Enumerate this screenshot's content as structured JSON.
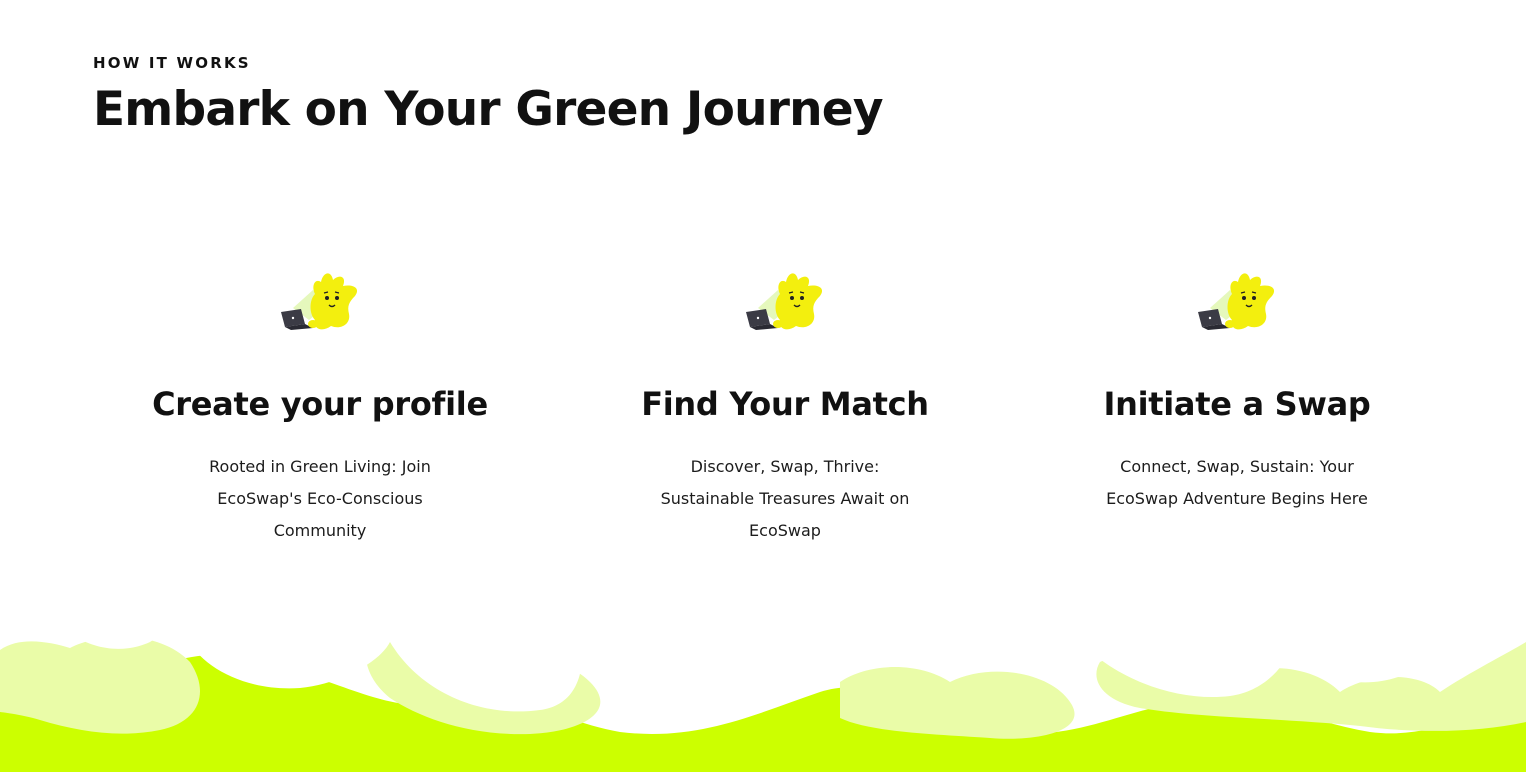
{
  "section": {
    "eyebrow": "HOW IT WORKS",
    "heading": "Embark on Your Green Journey"
  },
  "steps": [
    {
      "illustration": "mascot-with-laptop",
      "title": "Create your profile",
      "description": "Rooted in Green Living: Join EcoSwap's Eco-Conscious Community"
    },
    {
      "illustration": "mascot-with-laptop",
      "title": "Find Your Match",
      "description": "Discover, Swap, Thrive: Sustainable Treasures Await on EcoSwap"
    },
    {
      "illustration": "mascot-with-laptop",
      "title": "Initiate a Swap",
      "description": "Connect, Swap, Sustain: Your EcoSwap Adventure Begins Here"
    }
  ],
  "colors": {
    "text": "#111111",
    "mascot_yellow": "#f3ef0e",
    "laptop_glow": "#e2f7b5",
    "laptop": "#3b3b45",
    "wave_dark": "#ccff00",
    "wave_light": "#eafca8",
    "background": "#ffffff"
  }
}
